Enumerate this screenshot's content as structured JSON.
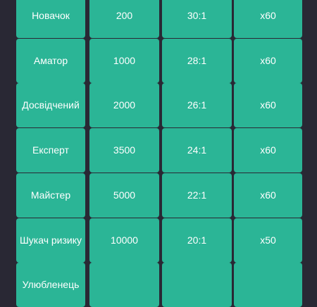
{
  "levels": [
    {
      "name": "Новачок",
      "amount": "200",
      "ratio": "30:1",
      "multiplier": "x60"
    },
    {
      "name": "Аматор",
      "amount": "1000",
      "ratio": "28:1",
      "multiplier": "x60"
    },
    {
      "name": "Досвідчений",
      "amount": "2000",
      "ratio": "26:1",
      "multiplier": "x60"
    },
    {
      "name": "Експерт",
      "amount": "3500",
      "ratio": "24:1",
      "multiplier": "x60"
    },
    {
      "name": "Майстер",
      "amount": "5000",
      "ratio": "22:1",
      "multiplier": "x60"
    },
    {
      "name": "Шукач ризику",
      "amount": "10000",
      "ratio": "20:1",
      "multiplier": "x50"
    },
    {
      "name": "Улюбленець",
      "amount": "",
      "ratio": "",
      "multiplier": ""
    }
  ],
  "colors": {
    "background": "#292834",
    "cell": "#2bb596",
    "text": "#ffffff"
  }
}
